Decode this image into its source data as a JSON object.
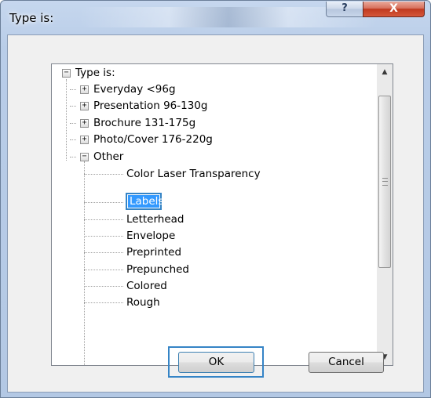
{
  "window": {
    "title": "Type is:",
    "help_label": "?",
    "close_label": "X"
  },
  "tree": {
    "root": {
      "label": "Type is:",
      "toggle": "−"
    },
    "items": [
      {
        "label": "Everyday <96g",
        "toggle": "+"
      },
      {
        "label": "Presentation 96-130g",
        "toggle": "+"
      },
      {
        "label": "Brochure 131-175g",
        "toggle": "+"
      },
      {
        "label": "Photo/Cover 176-220g",
        "toggle": "+"
      },
      {
        "label": "Other",
        "toggle": "−"
      }
    ],
    "other_children": [
      "Color Laser Transparency",
      "Labels",
      "Letterhead",
      "Envelope",
      "Preprinted",
      "Prepunched",
      "Colored",
      "Rough"
    ],
    "selected": "Labels"
  },
  "scrollbar": {
    "up_arrow": "▲",
    "down_arrow": "▼"
  },
  "buttons": {
    "ok": "OK",
    "cancel": "Cancel"
  }
}
